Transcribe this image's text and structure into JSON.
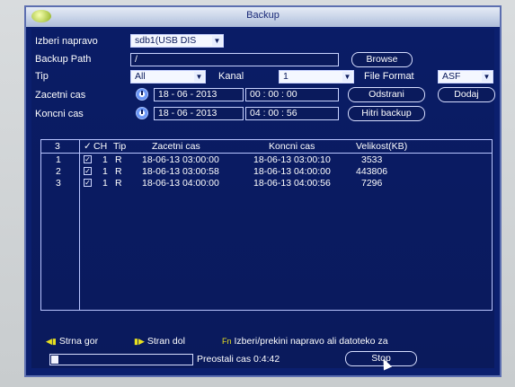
{
  "window": {
    "title": "Backup"
  },
  "form": {
    "device_label": "Izberi napravo",
    "device_value": "sdb1(USB DIS",
    "path_label": "Backup Path",
    "path_value": "/",
    "browse_btn": "Browse",
    "type_label": "Tip",
    "type_value": "All",
    "channel_label": "Kanal",
    "channel_value": "1",
    "file_format_label": "File Format",
    "file_format_value": "ASF",
    "start_label": "Zacetni cas",
    "start_date": "18 - 06 - 2013",
    "start_time": "00 : 00 : 00",
    "remove_btn": "Odstrani",
    "add_btn": "Dodaj",
    "end_label": "Koncni cas",
    "end_date": "18 - 06 - 2013",
    "end_time": "04 : 00 : 56",
    "quick_backup_btn": "Hitri backup"
  },
  "table": {
    "headers": {
      "count": "3",
      "check": "✓",
      "ch": "CH",
      "type": "Tip",
      "start": "Zacetni cas",
      "end": "Koncni cas",
      "size": "Velikost(KB)"
    },
    "rows": [
      {
        "no": "1",
        "ch": "1",
        "type": "R",
        "start": "18-06-13 03:00:00",
        "end": "18-06-13 03:00:10",
        "size": "3533"
      },
      {
        "no": "2",
        "ch": "1",
        "type": "R",
        "start": "18-06-13 03:00:58",
        "end": "18-06-13 04:00:00",
        "size": "443806"
      },
      {
        "no": "3",
        "ch": "1",
        "type": "R",
        "start": "18-06-13 04:00:00",
        "end": "18-06-13 04:00:56",
        "size": "7296"
      }
    ]
  },
  "footer": {
    "page_up": "Strna gor",
    "page_down": "Stran dol",
    "select_hint": "Izberi/prekini napravo ali datoteko za",
    "remaining": "Preostali cas 0:4:42",
    "stop_btn": "Stop",
    "progress_fraction": 0.05
  },
  "colors": {
    "background": "#0b1f6e",
    "text": "#ffffff",
    "hint_icon": "#e8e020"
  },
  "icons": {
    "clock": "clock-icon",
    "dropdown": "chevron-down-icon",
    "page_up": "page-up-icon",
    "page_down": "page-down-icon",
    "select": "fn-key-icon"
  }
}
